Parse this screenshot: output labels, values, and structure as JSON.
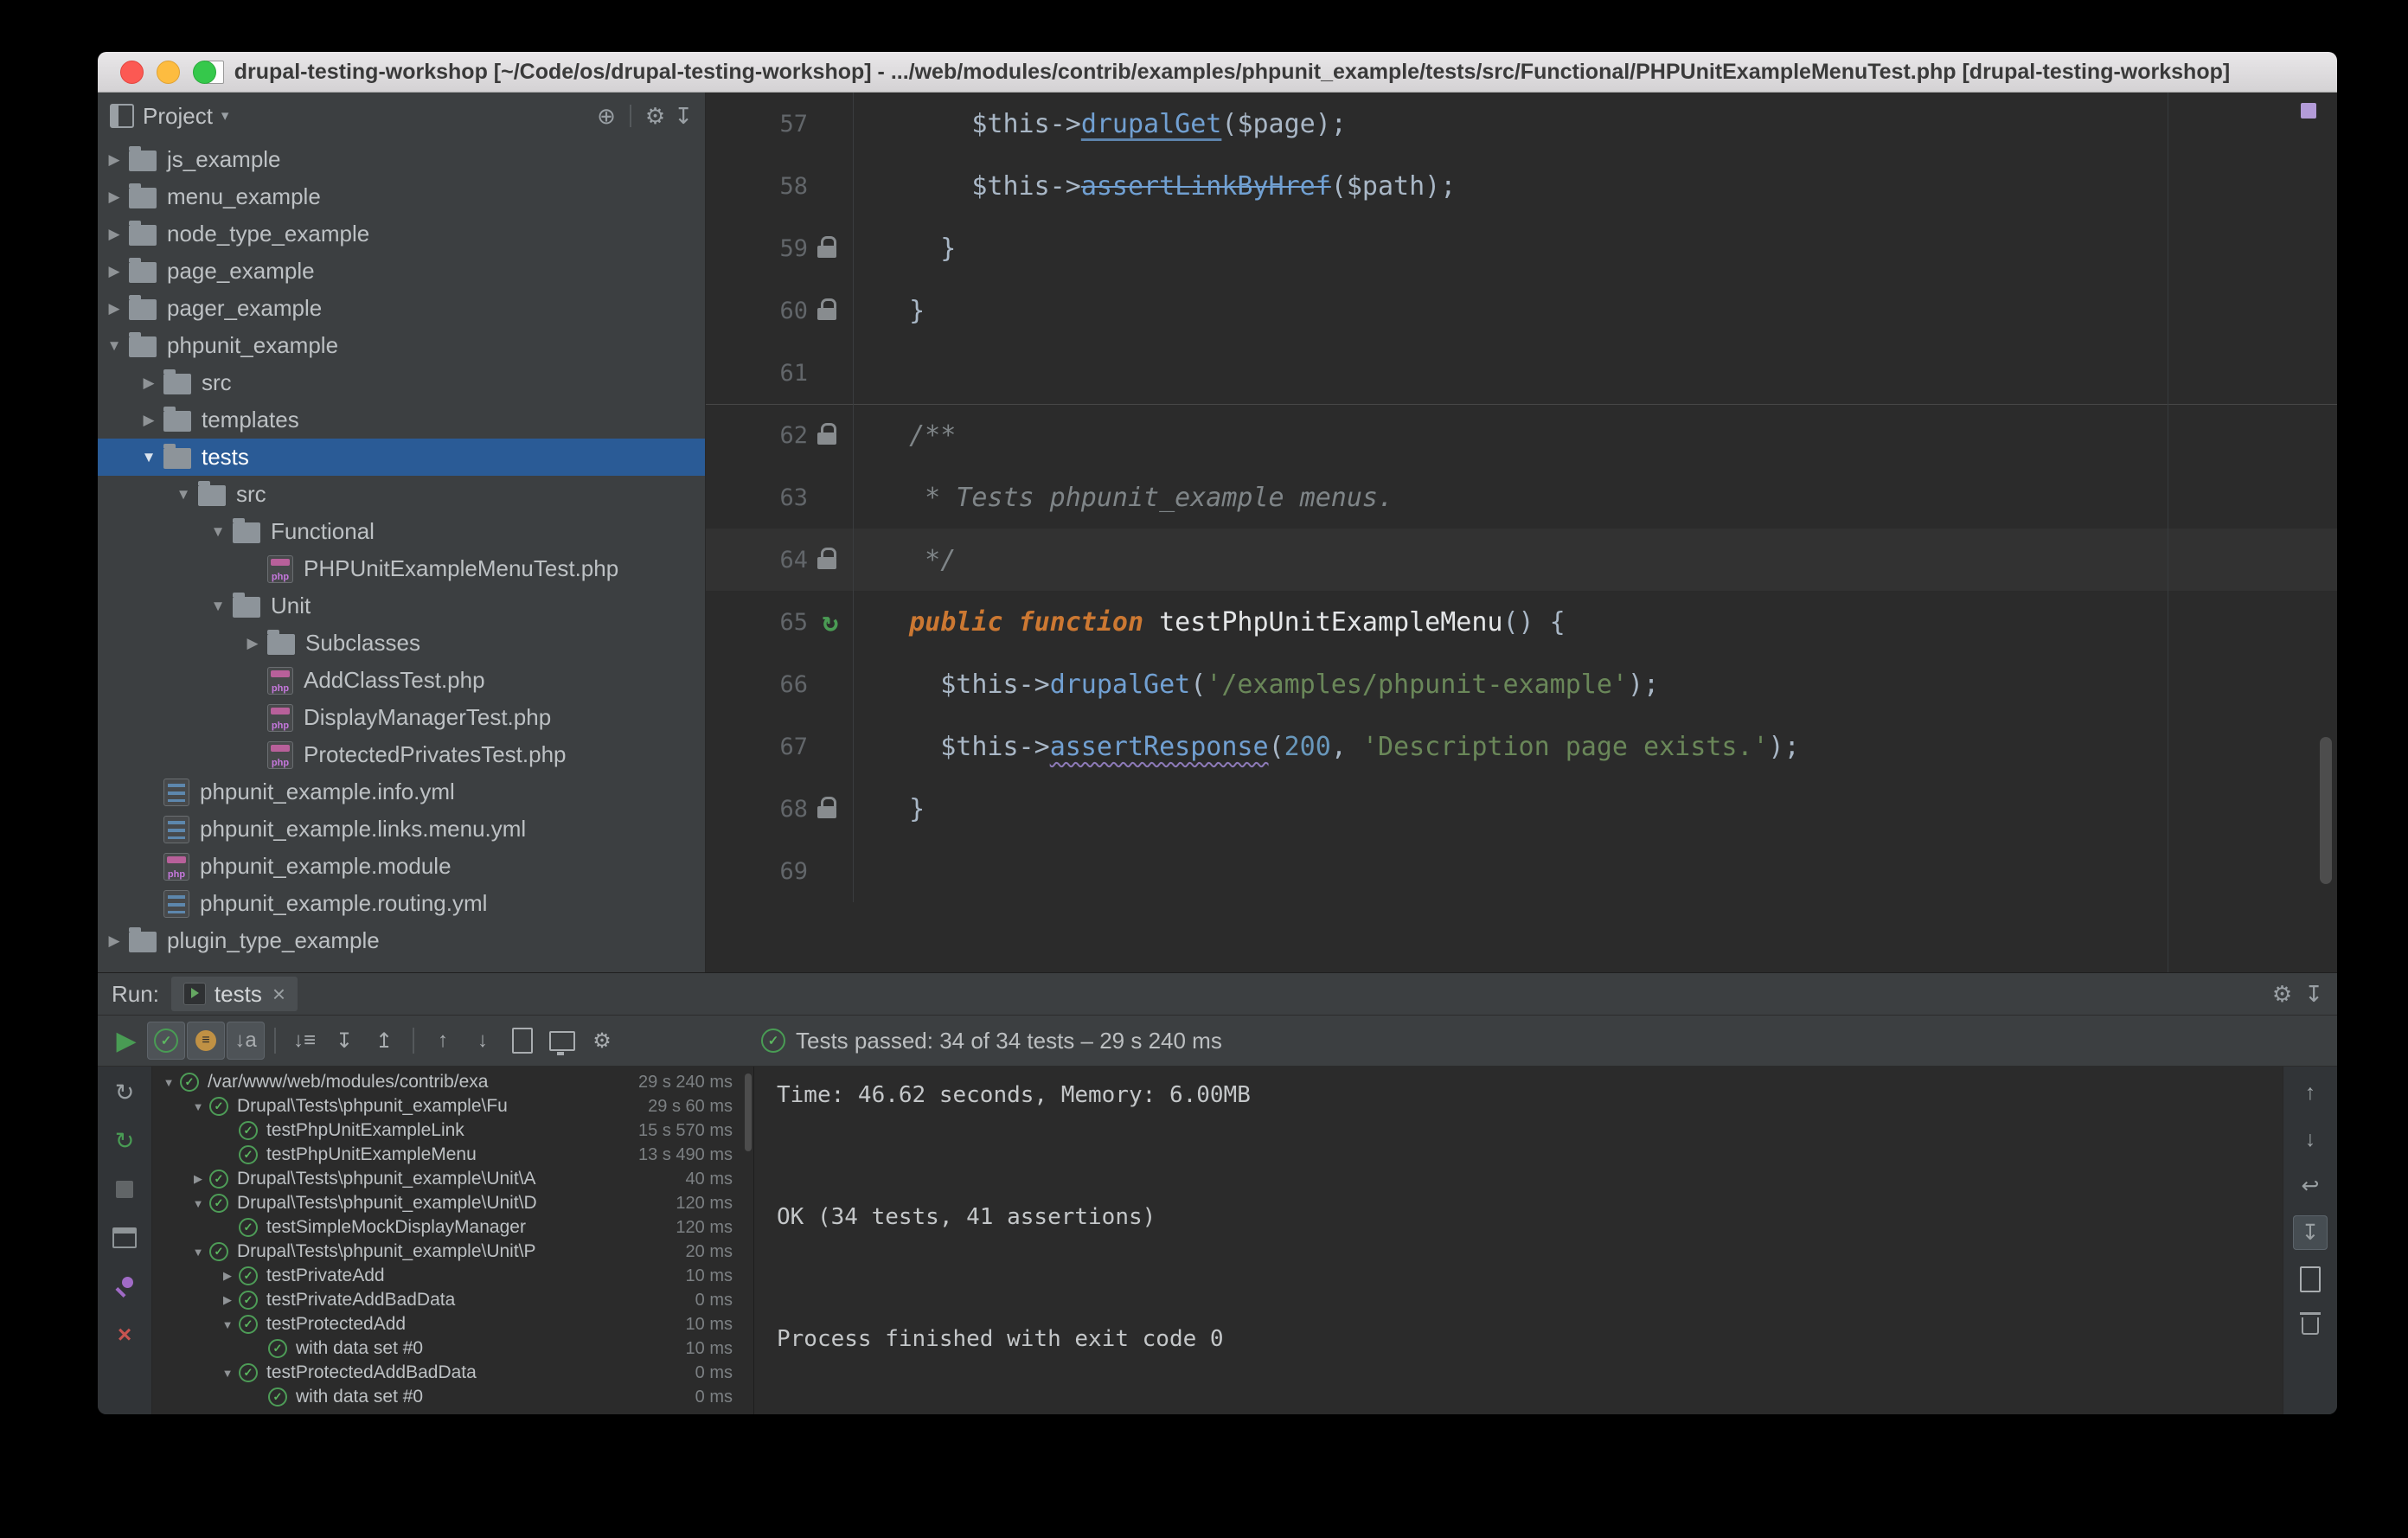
{
  "window": {
    "title": "drupal-testing-workshop [~/Code/os/drupal-testing-workshop] - .../web/modules/contrib/examples/phpunit_example/tests/src/Functional/PHPUnitExampleMenuTest.php [drupal-testing-workshop]"
  },
  "colors": {
    "editor_bg": "#2b2b2b",
    "panel_bg": "#3c3f41",
    "selection_blue": "#2a5b96",
    "pass_green": "#499C54",
    "error_red": "#C75450",
    "keyword_orange": "#cc7832",
    "string_green": "#6a8759"
  },
  "icons": {
    "expanded": "▼",
    "collapsed": "▶",
    "check": "✓",
    "close": "×",
    "gear": "⚙",
    "hide": "↧",
    "play": "▶",
    "up": "↑",
    "down": "↓",
    "expand_all": "↧",
    "collapse_all": "↥",
    "sort_alpha": "↓a",
    "sort_time": "↓≡",
    "rerun": "↻",
    "locate": "⊕",
    "caret": "▾",
    "soft_wrap": "↩",
    "scroll_end": "↧"
  },
  "project": {
    "header": "Project",
    "tree": [
      {
        "label": "js_example",
        "level": 1,
        "arrow": "closed",
        "icon": "folder"
      },
      {
        "label": "menu_example",
        "level": 1,
        "arrow": "closed",
        "icon": "folder"
      },
      {
        "label": "node_type_example",
        "level": 1,
        "arrow": "closed",
        "icon": "folder"
      },
      {
        "label": "page_example",
        "level": 1,
        "arrow": "closed",
        "icon": "folder"
      },
      {
        "label": "pager_example",
        "level": 1,
        "arrow": "closed",
        "icon": "folder"
      },
      {
        "label": "phpunit_example",
        "level": 1,
        "arrow": "open",
        "icon": "folder"
      },
      {
        "label": "src",
        "level": 2,
        "arrow": "closed",
        "icon": "folder"
      },
      {
        "label": "templates",
        "level": 2,
        "arrow": "closed",
        "icon": "folder"
      },
      {
        "label": "tests",
        "level": 2,
        "arrow": "open",
        "icon": "folder",
        "selected": true
      },
      {
        "label": "src",
        "level": 3,
        "arrow": "open",
        "icon": "folder"
      },
      {
        "label": "Functional",
        "level": 4,
        "arrow": "open",
        "icon": "folder"
      },
      {
        "label": "PHPUnitExampleMenuTest.php",
        "level": 5,
        "arrow": null,
        "icon": "php"
      },
      {
        "label": "Unit",
        "level": 4,
        "arrow": "open",
        "icon": "folder"
      },
      {
        "label": "Subclasses",
        "level": 5,
        "arrow": "closed",
        "icon": "folder"
      },
      {
        "label": "AddClassTest.php",
        "level": 5,
        "arrow": null,
        "icon": "php"
      },
      {
        "label": "DisplayManagerTest.php",
        "level": 5,
        "arrow": null,
        "icon": "php"
      },
      {
        "label": "ProtectedPrivatesTest.php",
        "level": 5,
        "arrow": null,
        "icon": "php"
      },
      {
        "label": "phpunit_example.info.yml",
        "level": 2,
        "arrow": null,
        "icon": "yml"
      },
      {
        "label": "phpunit_example.links.menu.yml",
        "level": 2,
        "arrow": null,
        "icon": "yml"
      },
      {
        "label": "phpunit_example.module",
        "level": 2,
        "arrow": null,
        "icon": "module"
      },
      {
        "label": "phpunit_example.routing.yml",
        "level": 2,
        "arrow": null,
        "icon": "yml"
      },
      {
        "label": "plugin_type_example",
        "level": 1,
        "arrow": "closed",
        "icon": "folder"
      }
    ]
  },
  "editor": {
    "lines": [
      {
        "num": 57,
        "segments": [
          [
            "      $this->",
            "plain"
          ],
          [
            "drupalGet",
            "method-underline"
          ],
          [
            "(",
            "plain"
          ],
          [
            "$page",
            "var"
          ],
          [
            ");",
            "plain"
          ]
        ]
      },
      {
        "num": 58,
        "segments": [
          [
            "      $this->",
            "plain"
          ],
          [
            "assertLinkByHref",
            "method-strike"
          ],
          [
            "(",
            "plain"
          ],
          [
            "$path",
            "var"
          ],
          [
            ");",
            "plain"
          ]
        ]
      },
      {
        "num": 59,
        "marker": "lock",
        "segments": [
          [
            "    }",
            "plain"
          ]
        ]
      },
      {
        "num": 60,
        "marker": "lock",
        "segments": [
          [
            "  }",
            "plain"
          ]
        ]
      },
      {
        "num": 61,
        "segments": []
      },
      {
        "num": 62,
        "marker": "lock",
        "separator": true,
        "segments": [
          [
            "  /**",
            "comment"
          ]
        ]
      },
      {
        "num": 63,
        "segments": [
          [
            "   * Tests phpunit_example menus.",
            "comment"
          ]
        ]
      },
      {
        "num": 64,
        "marker": "lock",
        "current": true,
        "segments": [
          [
            "   */",
            "comment"
          ]
        ]
      },
      {
        "num": 65,
        "marker": "run",
        "segments": [
          [
            "  ",
            "plain"
          ],
          [
            "public function",
            "keyword"
          ],
          [
            " ",
            "plain"
          ],
          [
            "testPhpUnitExampleMenu",
            "function"
          ],
          [
            "() {",
            "plain"
          ]
        ]
      },
      {
        "num": 66,
        "segments": [
          [
            "    $this->",
            "plain"
          ],
          [
            "drupalGet",
            "method"
          ],
          [
            "(",
            "plain"
          ],
          [
            "'/examples/phpunit-example'",
            "string"
          ],
          [
            ");",
            "plain"
          ]
        ]
      },
      {
        "num": 67,
        "segments": [
          [
            "    $this->",
            "plain"
          ],
          [
            "assertResponse",
            "method-wavy"
          ],
          [
            "(",
            "plain"
          ],
          [
            "200",
            "number"
          ],
          [
            ", ",
            "plain"
          ],
          [
            "'Description page exists.'",
            "string"
          ],
          [
            ");",
            "plain"
          ]
        ]
      },
      {
        "num": 68,
        "marker": "lock",
        "segments": [
          [
            "  }",
            "plain"
          ]
        ]
      },
      {
        "num": 69,
        "segments": []
      }
    ]
  },
  "run": {
    "label": "Run:",
    "tab_label": "tests",
    "status": "Tests passed: 34 of 34 tests – 29 s 240 ms",
    "tree": [
      {
        "level": 0,
        "arrow": "open",
        "label": "/var/www/web/modules/contrib/exa",
        "time": "29 s 240 ms"
      },
      {
        "level": 1,
        "arrow": "open",
        "label": "Drupal\\Tests\\phpunit_example\\Fu",
        "time": "29 s 60 ms"
      },
      {
        "level": 2,
        "arrow": null,
        "label": "testPhpUnitExampleLink",
        "time": "15 s 570 ms"
      },
      {
        "level": 2,
        "arrow": null,
        "label": "testPhpUnitExampleMenu",
        "time": "13 s 490 ms"
      },
      {
        "level": 1,
        "arrow": "closed",
        "label": "Drupal\\Tests\\phpunit_example\\Unit\\A",
        "time": "40 ms"
      },
      {
        "level": 1,
        "arrow": "open",
        "label": "Drupal\\Tests\\phpunit_example\\Unit\\D",
        "time": "120 ms"
      },
      {
        "level": 2,
        "arrow": null,
        "label": "testSimpleMockDisplayManager",
        "time": "120 ms"
      },
      {
        "level": 1,
        "arrow": "open",
        "label": "Drupal\\Tests\\phpunit_example\\Unit\\P",
        "time": "20 ms"
      },
      {
        "level": 2,
        "arrow": "closed",
        "label": "testPrivateAdd",
        "time": "10 ms"
      },
      {
        "level": 2,
        "arrow": "closed",
        "label": "testPrivateAddBadData",
        "time": "0 ms"
      },
      {
        "level": 2,
        "arrow": "open",
        "label": "testProtectedAdd",
        "time": "10 ms"
      },
      {
        "level": 3,
        "arrow": null,
        "label": "with data set #0",
        "time": "10 ms"
      },
      {
        "level": 2,
        "arrow": "open",
        "label": "testProtectedAddBadData",
        "time": "0 ms"
      },
      {
        "level": 3,
        "arrow": null,
        "label": "with data set #0",
        "time": "0 ms"
      }
    ],
    "console": [
      "Time: 46.62 seconds, Memory: 6.00MB",
      "",
      "",
      "OK (34 tests, 41 assertions)",
      "",
      "",
      "Process finished with exit code 0"
    ]
  }
}
